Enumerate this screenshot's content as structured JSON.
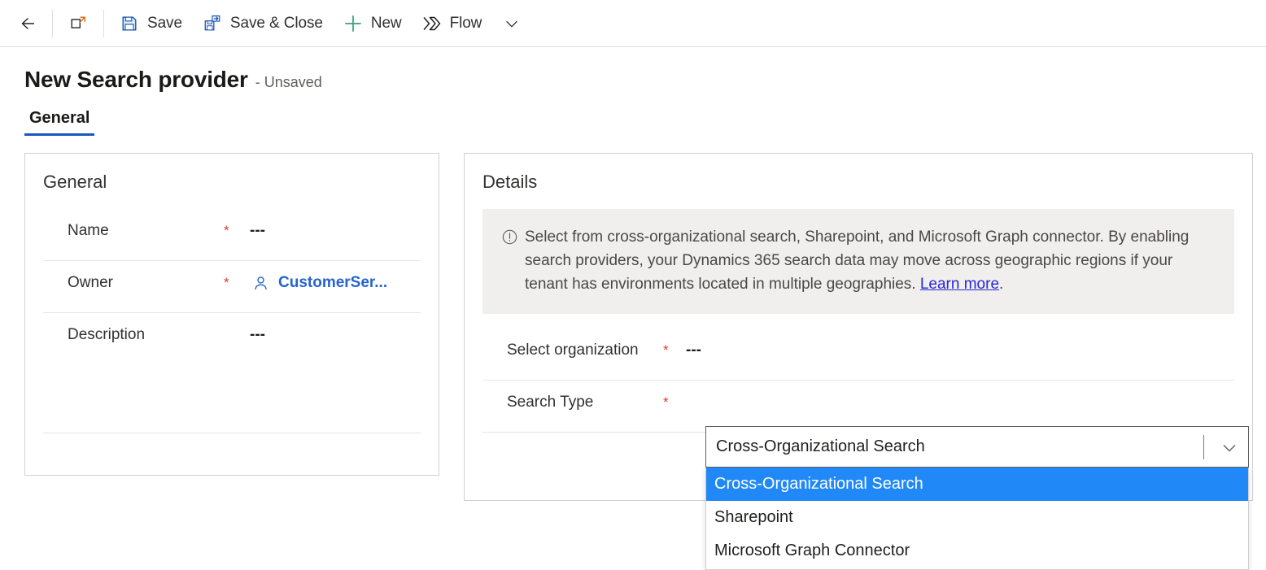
{
  "commandbar": {
    "buttons": [
      {
        "name": "back",
        "icon": "back-arrow-icon",
        "label": ""
      },
      {
        "name": "popout",
        "icon": "pop-out-icon",
        "label": ""
      },
      {
        "name": "save",
        "icon": "save-floppy-icon",
        "label": "Save"
      },
      {
        "name": "save-close",
        "icon": "save-and-close-icon",
        "label": "Save & Close"
      },
      {
        "name": "new",
        "icon": "plus-icon",
        "label": "New"
      },
      {
        "name": "flow",
        "icon": "flow-icon",
        "label": "Flow"
      },
      {
        "name": "more",
        "icon": "chevron-down-icon",
        "label": ""
      }
    ],
    "save_label": "Save",
    "save_close_label": "Save & Close",
    "new_label": "New",
    "flow_label": "Flow"
  },
  "header": {
    "title": "New Search provider",
    "subtitle": "- Unsaved"
  },
  "tabs": [
    {
      "label": "General",
      "active": true
    }
  ],
  "general_card": {
    "title": "General",
    "fields": [
      {
        "label": "Name",
        "required": "*",
        "value": "---",
        "type": "text"
      },
      {
        "label": "Owner",
        "required": "*",
        "value": "CustomerSer...",
        "type": "lookup",
        "icon": "person-icon"
      },
      {
        "label": "Description",
        "required": "",
        "value": "---",
        "type": "multiline"
      }
    ]
  },
  "details_card": {
    "title": "Details",
    "banner": {
      "icon": "info-circle-icon",
      "text": "Select from cross-organizational search, Sharepoint, and Microsoft Graph connector. By enabling search providers, your Dynamics 365 search data may move across geographic regions if your tenant has environments located in multiple geographies. ",
      "link_text": "Learn more",
      "text_after": "."
    },
    "fields": [
      {
        "label": "Select organization",
        "required": "*",
        "value": "---"
      },
      {
        "label": "Search Type",
        "required": "*",
        "value": ""
      }
    ]
  },
  "search_type_dropdown": {
    "value": "Cross-Organizational Search",
    "expanded": true,
    "options": [
      {
        "label": "Cross-Organizational Search",
        "selected": true
      },
      {
        "label": "Sharepoint",
        "selected": false
      },
      {
        "label": "Microsoft Graph Connector",
        "selected": false
      }
    ]
  },
  "colors": {
    "accent_blue": "#1a56c4",
    "link_blue": "#2564cf",
    "highlight_blue": "#2189f7",
    "required_red": "#e33b2e",
    "learn_more": "#2727d6",
    "banner_bg": "#f0efee"
  }
}
